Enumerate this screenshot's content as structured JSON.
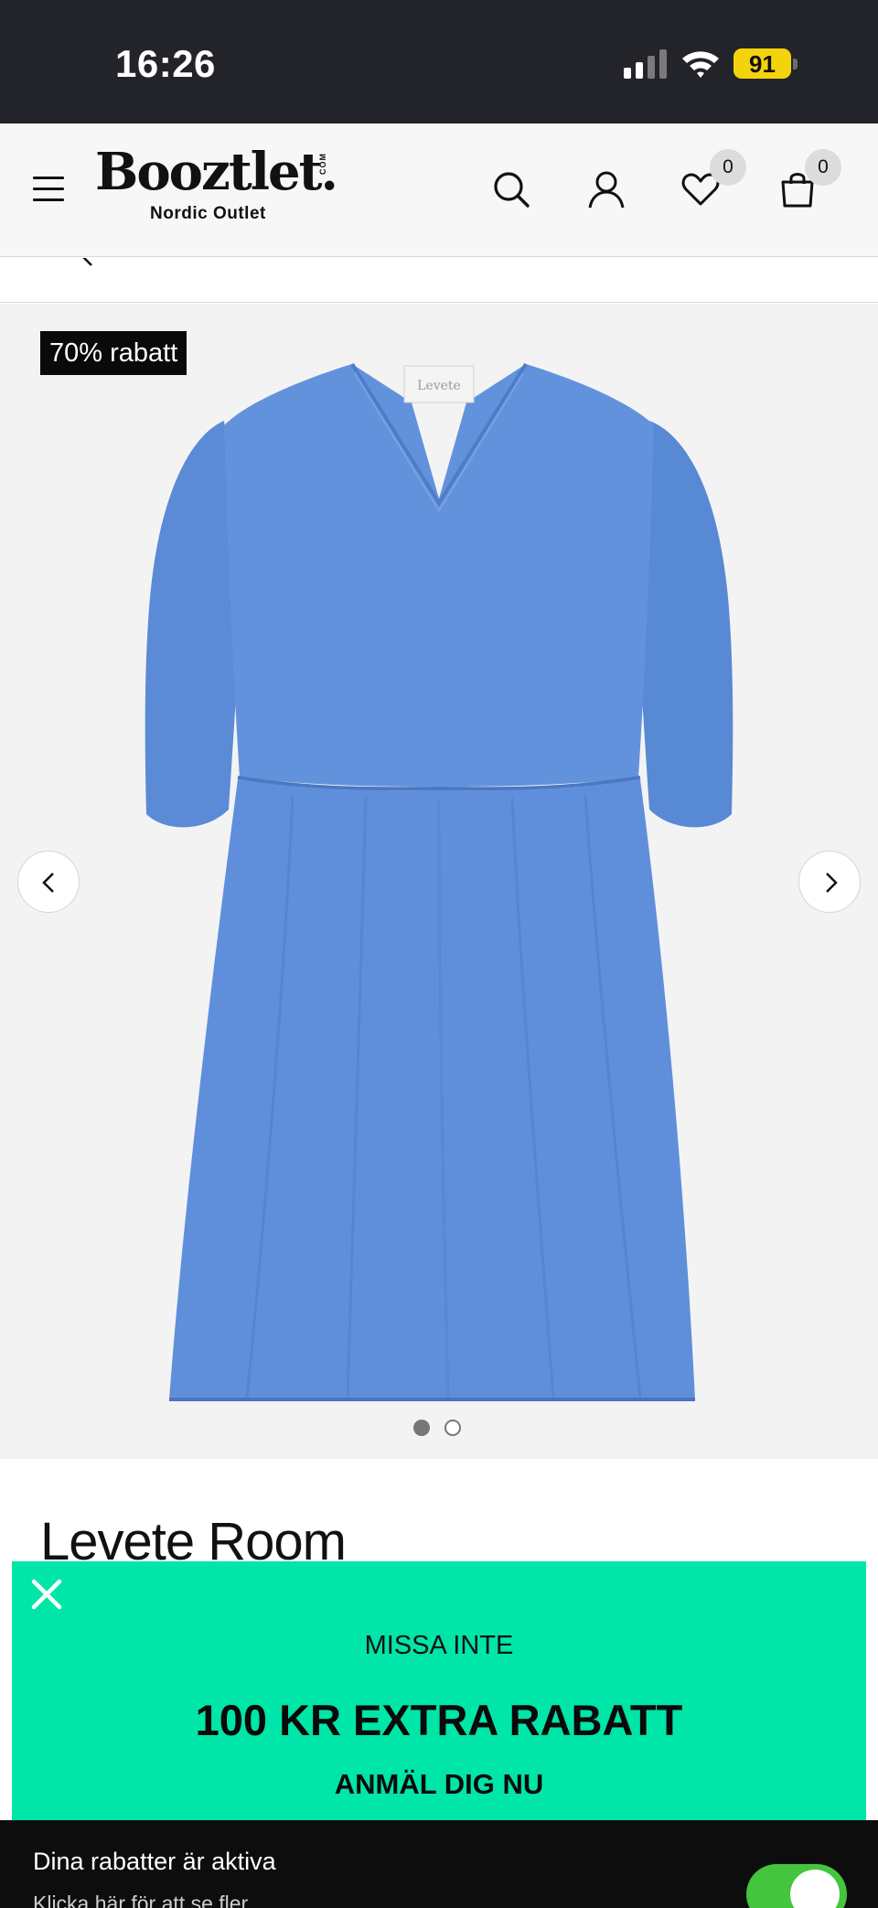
{
  "status_bar": {
    "time": "16:26",
    "battery": "91"
  },
  "header": {
    "logo_word": "Booztlet.",
    "logo_com": "COM",
    "logo_tagline": "Nordic Outlet",
    "wishlist_count": "0",
    "cart_count": "0"
  },
  "gallery": {
    "discount_label": "70% rabatt",
    "label_text": "Levete",
    "image_count": 2,
    "active_index": 0,
    "garment_color": "#5b8ad6"
  },
  "product": {
    "brand": "Levete Room"
  },
  "promo": {
    "headline_small": "MISSA INTE",
    "headline_big": "100 KR EXTRA RABATT",
    "cta": "ANMÄL DIG NU",
    "background": "#00e5a8"
  },
  "bottom_bar": {
    "title": "Dina rabatter är aktiva",
    "subtitle": "Klicka här för att se fler",
    "toggle_on": true,
    "toggle_color": "#45c43d"
  }
}
